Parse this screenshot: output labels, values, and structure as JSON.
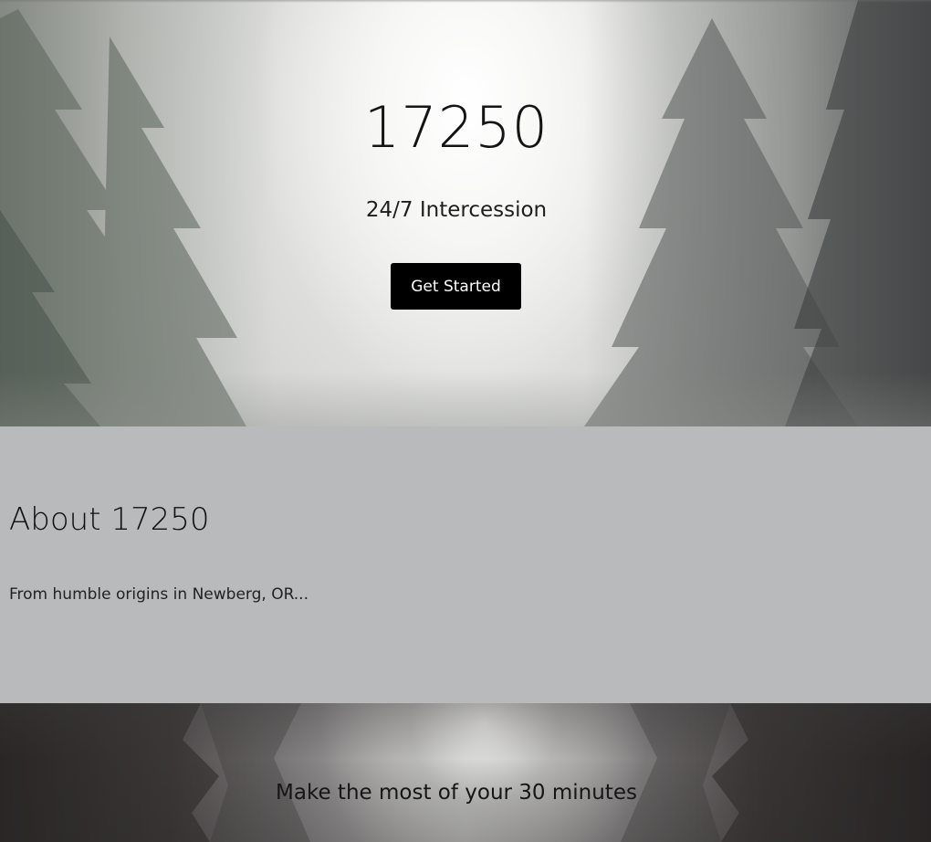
{
  "hero": {
    "title": "17250",
    "subtitle": "24/7 Intercession",
    "cta_label": "Get Started"
  },
  "about": {
    "heading": "About 17250",
    "text": "From humble origins in Newberg, OR..."
  },
  "bottom": {
    "text": "Make the most of your 30 minutes"
  },
  "colors": {
    "button_bg": "#000000",
    "button_text": "#ffffff",
    "about_bg": "#b9babb"
  }
}
